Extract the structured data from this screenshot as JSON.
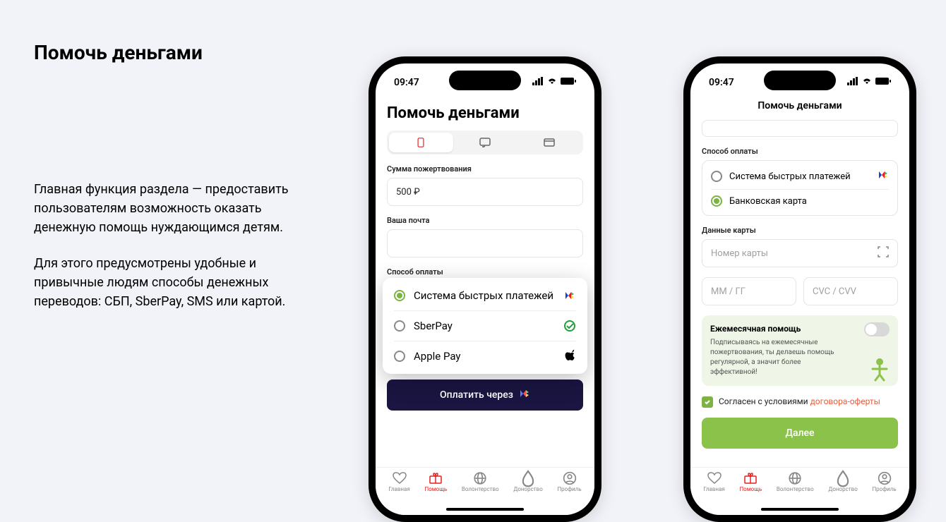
{
  "page": {
    "title": "Помочь деньгами",
    "desc1": "Главная функция раздела — предоставить пользователям возможность оказать денежную помощь нуждающимся детям.",
    "desc2": "Для этого предусмотрены удобные и привычные людям способы денежных переводов: СБП, SberPay, SMS или картой."
  },
  "status": {
    "time": "09:47"
  },
  "screen1": {
    "title": "Помочь деньгами",
    "amount_label": "Сумма пожертвования",
    "amount_value": "500 ₽",
    "email_label": "Ваша почта",
    "method_label": "Способ оплаты",
    "options": [
      {
        "label": "Система быстрых платежей",
        "selected": true,
        "icon": "sbp"
      },
      {
        "label": "SberPay",
        "selected": false,
        "icon": "sber"
      },
      {
        "label": "Apple Pay",
        "selected": false,
        "icon": "apple"
      }
    ],
    "pay_button": "Оплатить через"
  },
  "screen2": {
    "nav_title": "Помочь деньгами",
    "method_label": "Способ оплаты",
    "methods": [
      {
        "label": "Система быстрых платежей",
        "selected": false,
        "icon": "sbp"
      },
      {
        "label": "Банковская карта",
        "selected": true
      }
    ],
    "card_data_label": "Данные карты",
    "card_number_placeholder": "Номер карты",
    "expiry_placeholder": "ММ / ГГ",
    "cvc_placeholder": "CVC / CVV",
    "monthly_title": "Ежемесячная помощь",
    "monthly_text": "Подписываясь на ежемесячные пожертвования, ты делаешь помощь регулярной, а значит более эффективной!",
    "consent_text": "Согласен с условиями ",
    "consent_link": "договора-оферты",
    "next_button": "Далее"
  },
  "tabs": [
    {
      "label": "Главная"
    },
    {
      "label": "Помощь"
    },
    {
      "label": "Волонтерство"
    },
    {
      "label": "Донорство"
    },
    {
      "label": "Профиль"
    }
  ]
}
